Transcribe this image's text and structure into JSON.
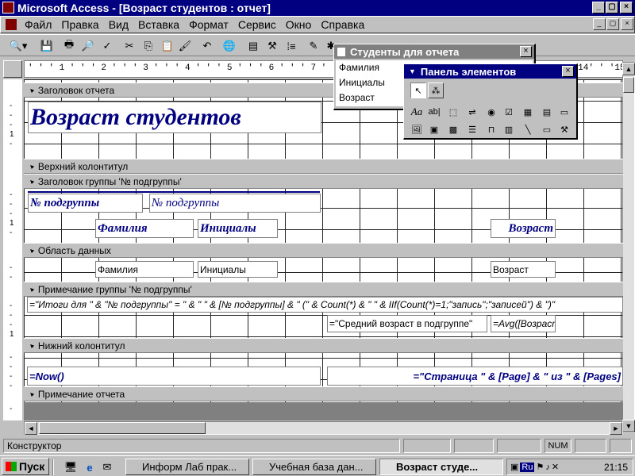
{
  "app": {
    "title": "Microsoft Access - [Возраст студентов : отчет]",
    "title_buttons": [
      "_",
      "▢",
      "×"
    ]
  },
  "menu": [
    "Файл",
    "Правка",
    "Вид",
    "Вставка",
    "Формат",
    "Сервис",
    "Окно",
    "Справка"
  ],
  "ruler": {
    "text": "' ' ' 1 ' ' ' 2 ' ' ' 3 ' ' ' 4 ' ' ' 5 ' ' ' 6 ' ' ' 7 ' ' ' 8 ' ' ' 9 ' ' '10' ' '11' ' '12' ' '13' ' '14' ' '15' ' '"
  },
  "sections": {
    "report_header": "Заголовок отчета",
    "page_header": "Верхний колонтитул",
    "group_header": "Заголовок группы '№ подгруппы'",
    "detail": "Область данных",
    "group_footer": "Примечание группы '№ подгруппы'",
    "page_footer": "Нижний колонтитул",
    "report_footer": "Примечание отчета"
  },
  "controls": {
    "report_title": "Возраст студентов",
    "group_label": "№ подгруппы",
    "group_field": "№ подгруппы",
    "col_lastname": "Фамилия",
    "col_initials": "Инициалы",
    "col_age": "Возраст",
    "field_lastname": "Фамилия",
    "field_initials": "Инициалы",
    "field_age": "Возраст",
    "totals_expr": "=\"Итоги для \" & \"№ подгруппы\" = \" & \" \" & [№ подгруппы] & \" (\" & Count(*) & \" \" & IIf(Count(*)=1;\"запись\";\"записей\") & \")\"",
    "avg_label": "=\"Средний возраст в подгруппе\"",
    "avg_expr": "=Avg([Возраст",
    "now_expr": "=Now()",
    "page_expr": "=\"Страница \" & [Page] & \" из \" & [Pages]"
  },
  "field_list": {
    "title": "Студенты для отчета",
    "fields": [
      "Фамилия",
      "Инициалы",
      "Возраст"
    ]
  },
  "toolbox": {
    "title": "Панель элементов"
  },
  "status": {
    "mode": "Конструктор",
    "num": "NUM"
  },
  "taskbar": {
    "start": "Пуск",
    "tasks": [
      "Информ Лаб прак...",
      "Учебная база дан...",
      "Возраст студе..."
    ],
    "clock": "21:15",
    "tray_lang": "Ru"
  },
  "colors": {
    "titlebar": "#000080",
    "report_text": "#000080"
  }
}
